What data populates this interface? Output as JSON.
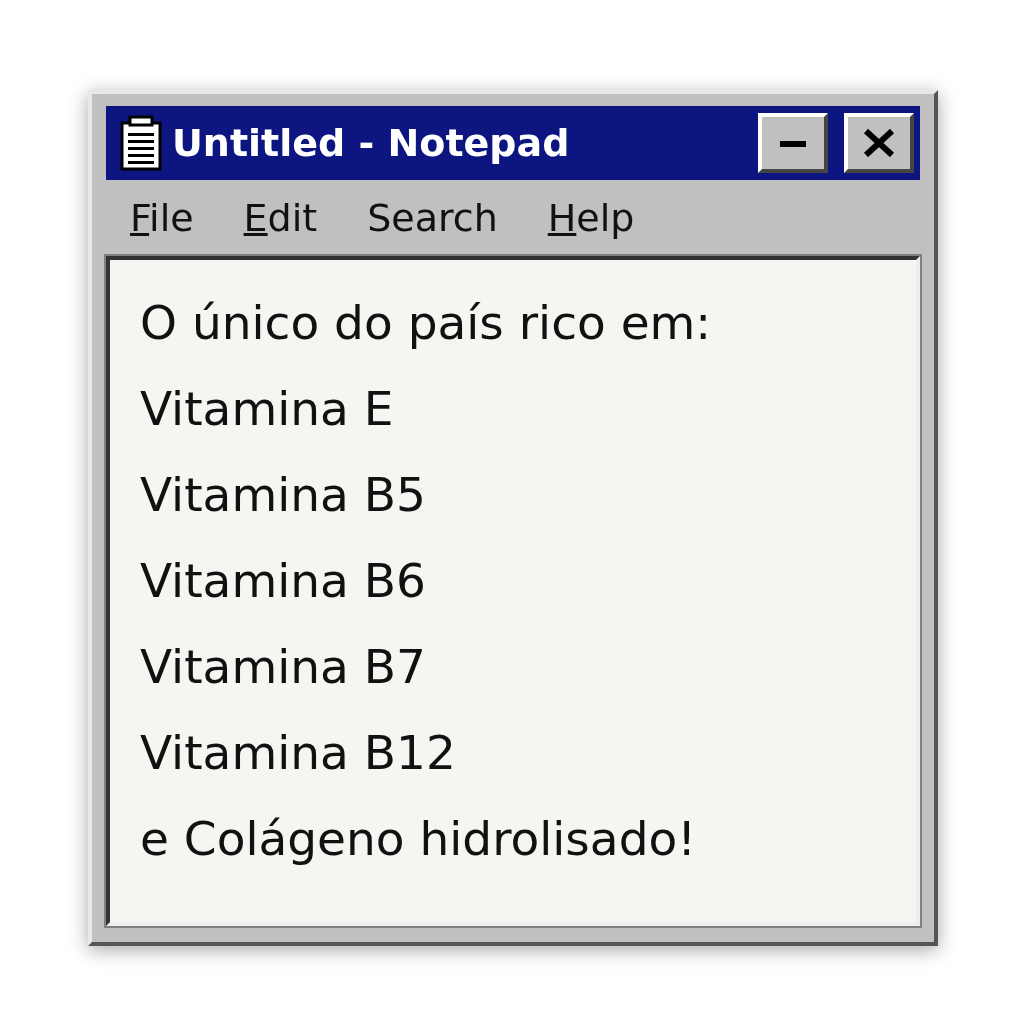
{
  "window": {
    "title": "Untitled - Notepad"
  },
  "title_buttons": [
    {
      "kind": "minimize"
    },
    {
      "kind": "close"
    }
  ],
  "menu": [
    {
      "label": "File",
      "has_mnemonic": true
    },
    {
      "label": "Edit",
      "has_mnemonic": true
    },
    {
      "label": "Search",
      "has_mnemonic": false
    },
    {
      "label": "Help",
      "has_mnemonic": true
    }
  ],
  "document": {
    "lines": [
      "O único do país rico em:",
      "Vitamina E",
      "Vitamina B5",
      "Vitamina B6",
      "Vitamina B7",
      "Vitamina B12",
      "e Colágeno hidrolisado!"
    ]
  }
}
